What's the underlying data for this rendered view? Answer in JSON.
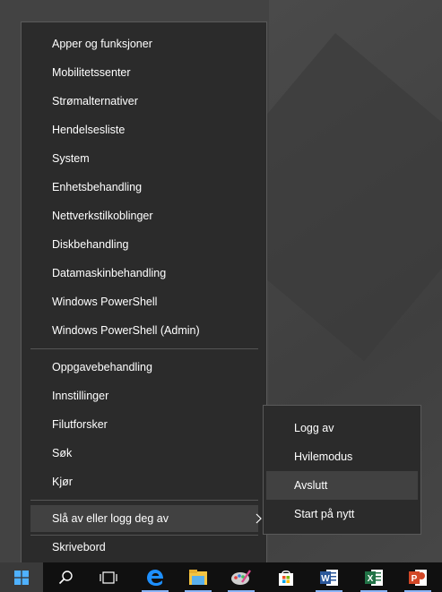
{
  "menu": {
    "items_group1": [
      "Apper og funksjoner",
      "Mobilitetssenter",
      "Strømalternativer",
      "Hendelsesliste",
      "System",
      "Enhetsbehandling",
      "Nettverkstilkoblinger",
      "Diskbehandling",
      "Datamaskinbehandling",
      "Windows PowerShell",
      "Windows PowerShell (Admin)"
    ],
    "items_group2": [
      "Oppgavebehandling",
      "Innstillinger",
      "Filutforsker",
      "Søk",
      "Kjør"
    ],
    "shutdown_item": "Slå av eller logg deg av",
    "desktop_item": "Skrivebord"
  },
  "submenu": {
    "items": [
      "Logg av",
      "Hvilemodus",
      "Avslutt",
      "Start på nytt"
    ],
    "hovered": "Avslutt"
  },
  "taskbar": {
    "apps": [
      "start-icon",
      "search-icon",
      "task-view-icon",
      "edge-icon",
      "file-explorer-icon",
      "paint-icon",
      "store-icon",
      "word-icon",
      "excel-icon",
      "powerpoint-icon"
    ]
  }
}
